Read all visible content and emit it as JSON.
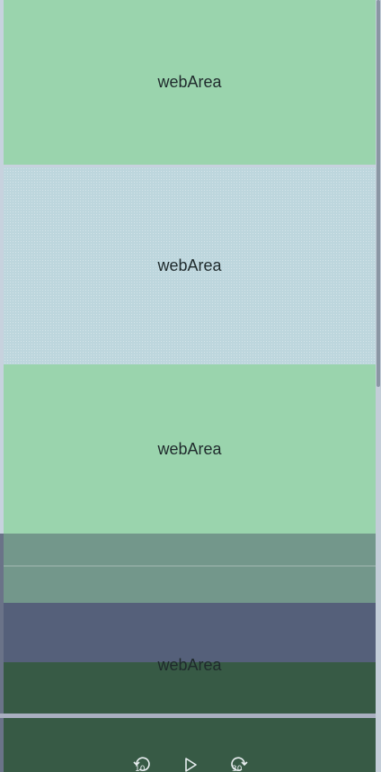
{
  "web_areas": [
    {
      "label": "webArea"
    },
    {
      "label": "webArea"
    },
    {
      "label": "webArea"
    },
    {
      "label": "webArea"
    }
  ],
  "player_controls": {
    "rewind_seconds": "10",
    "forward_seconds": "30"
  },
  "colors": {
    "green_panel": "#9ad4ad",
    "blue_panel": "#bdd6dd",
    "dark_green": "#375a45",
    "slate": "#55607a"
  },
  "icons": {
    "rewind": "rewind-10-icon",
    "play": "play-icon",
    "forward": "forward-30-icon"
  }
}
